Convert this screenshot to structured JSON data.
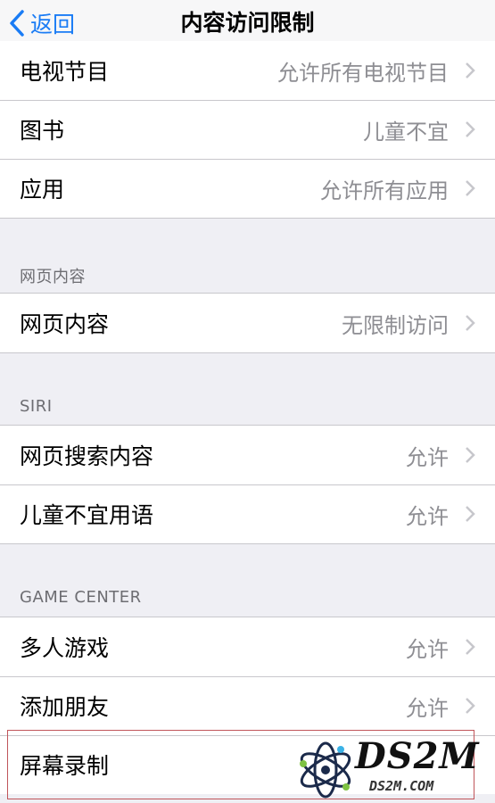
{
  "navbar": {
    "back_label": "返回",
    "title": "内容访问限制"
  },
  "groups": {
    "top": [
      {
        "label": "电视节目",
        "value": "允许所有电视节目"
      },
      {
        "label": "图书",
        "value": "儿童不宜"
      },
      {
        "label": "应用",
        "value": "允许所有应用"
      }
    ],
    "web": {
      "header": "网页内容",
      "rows": [
        {
          "label": "网页内容",
          "value": "无限制访问"
        }
      ]
    },
    "siri": {
      "header": "SIRI",
      "rows": [
        {
          "label": "网页搜索内容",
          "value": "允许"
        },
        {
          "label": "儿童不宜用语",
          "value": "允许"
        }
      ]
    },
    "game_center": {
      "header": "GAME CENTER",
      "rows": [
        {
          "label": "多人游戏",
          "value": "允许"
        },
        {
          "label": "添加朋友",
          "value": "允许"
        },
        {
          "label": "屏幕录制",
          "value": ""
        }
      ]
    }
  },
  "watermark": {
    "logo_text": "DS2M",
    "sub_text": "DS2M.COM"
  },
  "colors": {
    "accent": "#1a7cf5",
    "secondary_text": "#8e8e93",
    "background": "#efeff4"
  }
}
